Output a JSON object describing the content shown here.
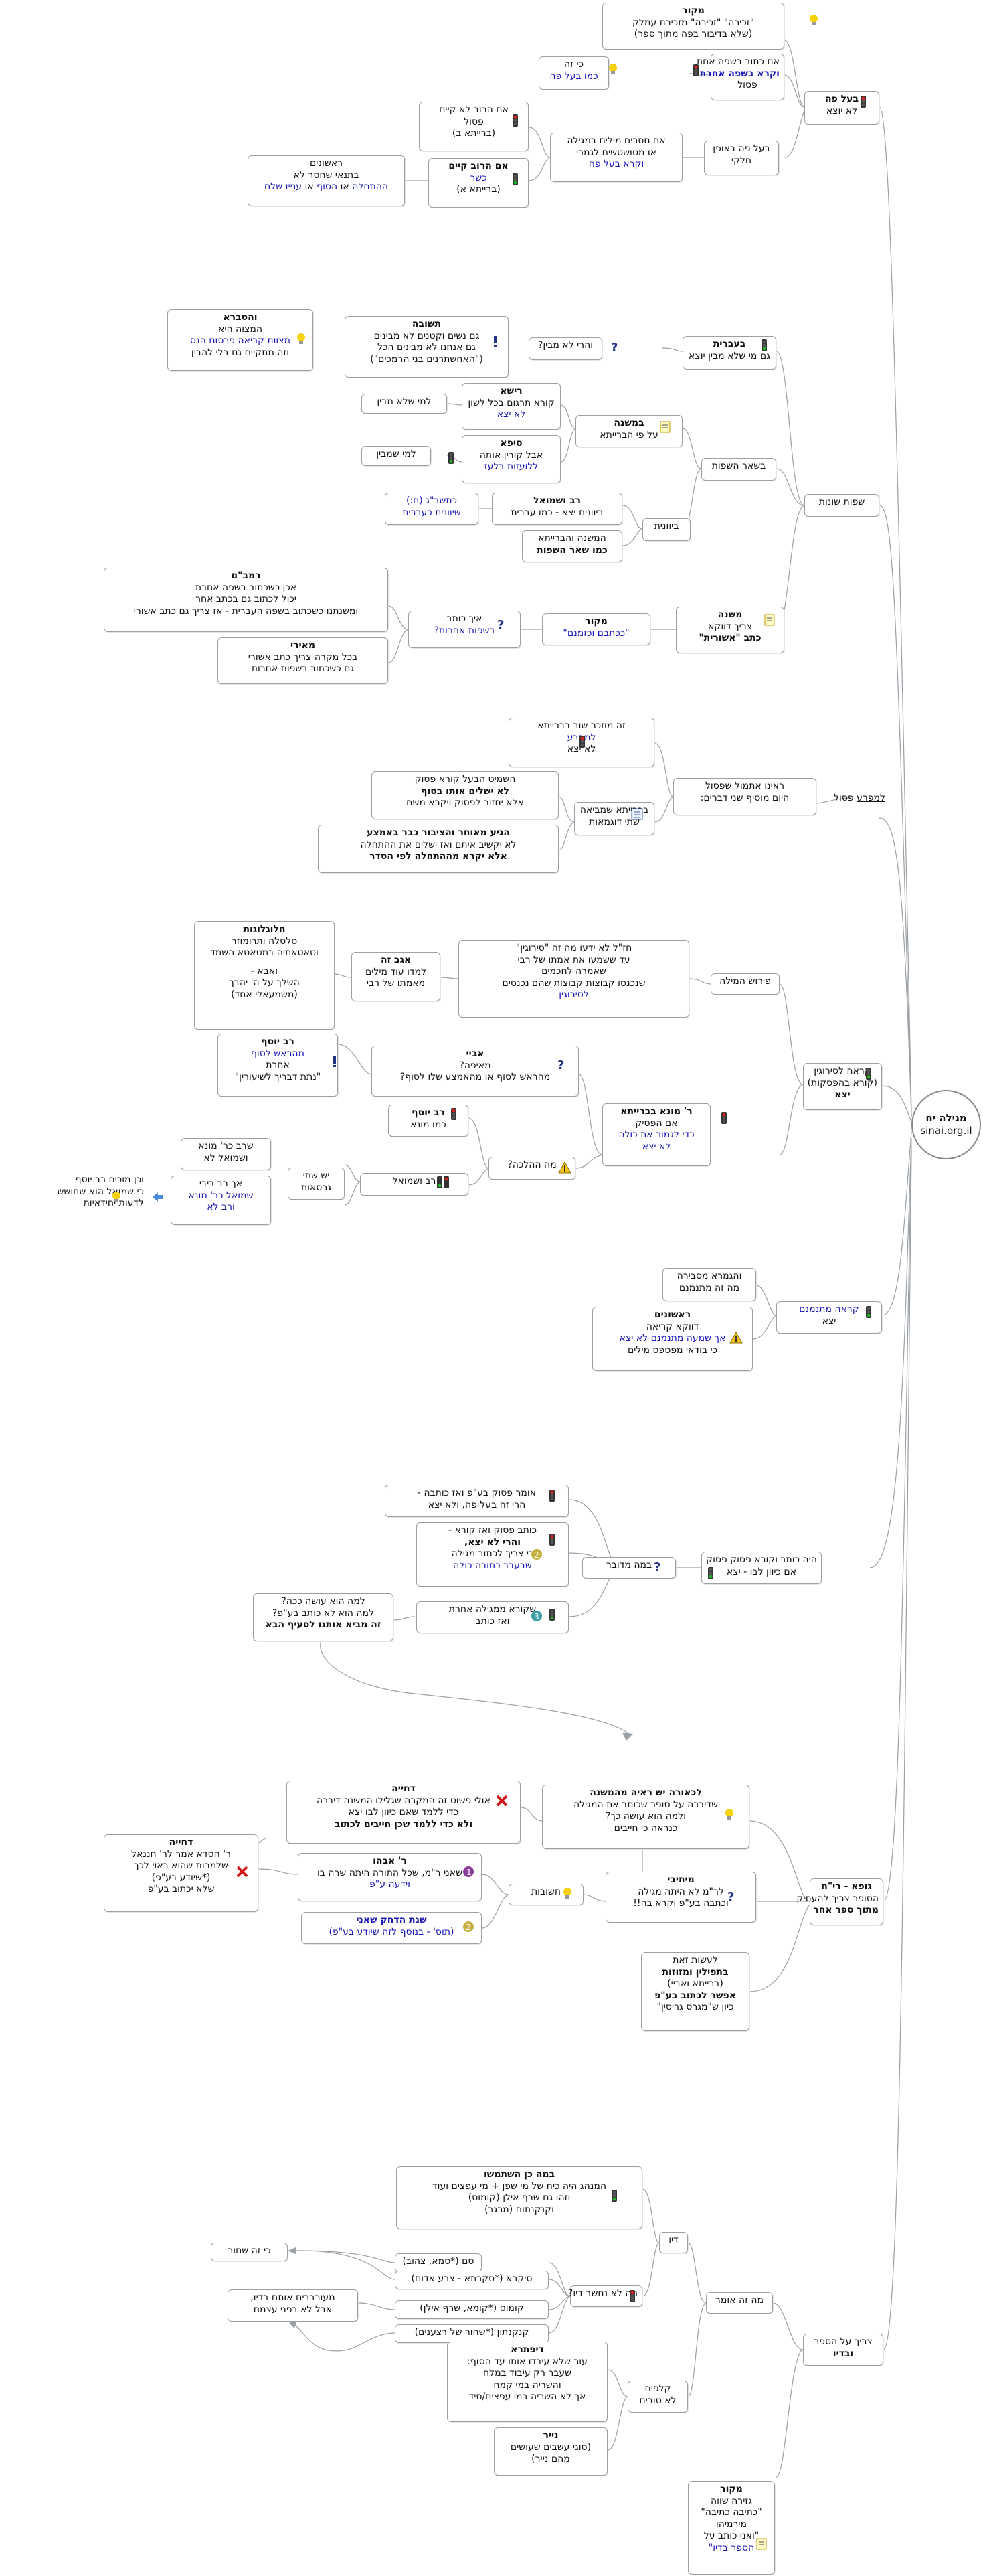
{
  "center": {
    "l1": "מגילה יח",
    "l2": "sinai.org.il"
  },
  "colors": {
    "line": "#9aa0a6",
    "blue": "#1a1ab8",
    "red": "#d01818",
    "green": "#2a9a2a",
    "warn": "#f0c020"
  },
  "n": {
    "s1": {
      "l1": "מקור",
      "l2": "\"זכירה\" \"זכירה\" מזכירת עמלק",
      "l3": "(שלא בדיבור בפה מתוך ספר)"
    },
    "s2": {
      "l1": "כי זה",
      "l2": "כמו בעל פה"
    },
    "s3": {
      "l1": "אם כתוב בשפה אחת",
      "l2": "וקרא בשפה אחרת",
      "l3": "פסול"
    },
    "s4": {
      "l1": "בעל פה",
      "l2": "לא יוצא"
    },
    "s5": {
      "l1": "אם הרוב לא קיים",
      "l2": "פסול",
      "l3": "(ברייתא ב)"
    },
    "s6": {
      "l1": "אם חסרים מילים במגילה",
      "l2": "או מטושטשים לגמרי",
      "l3": "וקרא בעל פה"
    },
    "s7": {
      "l1": "בעל פה באופן",
      "l2": "חלקי"
    },
    "s8": {
      "l1": "ראשונים",
      "l2": "בתנאי שחסר לא",
      "l3a": "ההתחלה",
      "l3b": " או ",
      "l3c": "הסוף",
      "l3d": " או ",
      "l3e": "ענייו",
      "l3f": " שלם"
    },
    "s9": {
      "l1": "אם הרוב קיים",
      "l2": "כשר",
      "l3": "(ברייתא א)"
    },
    "g1": {
      "l1": "והסברא",
      "l2": "המצוה היא",
      "l3": "פרסום הנס",
      "l3p": "מצוות קריאה ",
      "l4": "וזה מתקיים גם בלי להבין"
    },
    "g2": {
      "l1": "תשובה",
      "l2": "גם נשים וקטנים לא מבינים",
      "l3": "גם אנחנו לא מבינים הכל",
      "l4": "(\"האחשתרנים בני הרמכים\")"
    },
    "g3": {
      "l1": "והרי לא מבין?"
    },
    "g4": {
      "l1": "בעברית",
      "l2": "גם מי שלא מבין יוצא"
    },
    "g5": {
      "l1": "רישא",
      "l2": "קורא תרגום בכל לשון",
      "l3": "לא יצא"
    },
    "g6": {
      "l1": "למי שלא מבין"
    },
    "g7": {
      "l1": "במשנה",
      "l2": "על פי הברייתא"
    },
    "g8": {
      "l1": "סיפא",
      "l2": "אבל קורין אותה",
      "l3": "ללועזות בלעז"
    },
    "g9": {
      "l1": "למי שמבין"
    },
    "g10": {
      "l1": "בשאר השפות"
    },
    "g11": {
      "l1": "כתשב\"ג (ח:)",
      "l2": "שיוונית כעברית"
    },
    "g12": {
      "l1": "רב ושמואל",
      "l2": "ביוונית יצא - כמו עברית"
    },
    "g13": {
      "l1": "ביוונית"
    },
    "g14": {
      "l1": "המשנה והברייתא",
      "l2": "כמו שאר השפות"
    },
    "g15": {
      "l1": "שפות שונות"
    },
    "g16": {
      "l1": "רמב\"ם",
      "l2": "אכן כשכתוב בשפה אחרת",
      "l3": "יכול לכתוב גם בכתב אחר",
      "l4": "ומשנתנו כשכתוב בשפה העברית - אז צריך גם כתב אשורי"
    },
    "g17": {
      "l1": "איך כותב",
      "l2": "בשפות אחרות?"
    },
    "g18": {
      "l1": "מקור",
      "l2": "\"ככתבם וכזמנם\""
    },
    "g19": {
      "l1": "משנה",
      "l2": "צריך דווקא",
      "l3": "כתב \"אשורית\""
    },
    "g20": {
      "l1": "מאירי",
      "l2": "בכל מקרה צריך כתב אשורי",
      "l3": "גם כשכתוב בשפות אחרות"
    },
    "k1": {
      "l1": "זה מוזכר שוב בברייתא",
      "l2": "למפרע",
      "l3": "לא יצא"
    },
    "k2": {
      "l1": "למפרע פסול"
    },
    "k3": {
      "l1": "ראינו אתמול שפסול",
      "l2": "היום מוסיף שני דברים:"
    },
    "k4": {
      "l1": "השמיט הבעל קורא פסוק",
      "l2": "לא ישלים אותו בסוף",
      "l3": "אלא יחזור לפסוק ויקרא משם"
    },
    "k5": {
      "l1": "בברייתא שמביאה",
      "l2": "שתי דוגמאות"
    },
    "k6": {
      "l1": "הגיע מאוחר והציבור כבר באמצע",
      "l2": "לא יקשיב איתם ואז ישלים את ההתחלה",
      "l3": "אלא יקרא מההתחלה לפי הסדר"
    },
    "r1": {
      "l1": "חלוגלוגות",
      "l2": "סלסלה ותרומוזר",
      "l3": "וטאטאתיה במטאטא השמד",
      "l4": "ואבא -",
      "l5": "השלך על ה' יהבך",
      "l6": "(משמעאלי אחד)"
    },
    "r2": {
      "l1": "אגב זה",
      "l2": "למדו עוד מילים",
      "l3": "מאמתו של רבי"
    },
    "r3": {
      "l1": "חז\"ל לא ידעו מה זה \"סירוגין\"",
      "l2": "עד ששמעו את אמתו של רבי",
      "l3": "שאמרה לחכמים",
      "l4": "שנכנסו קבוצות קבוצות שהם נכנסים",
      "l5": "לסירוגין"
    },
    "r4": {
      "l1": "פירוש המילה"
    },
    "r5": {
      "l1": "רב יוסף",
      "l2": "מהראש לסוף",
      "l3": "אחרת",
      "l4": "\"נתת דבריך לשיעורין\""
    },
    "r6": {
      "l1": "אביי",
      "l2": "מאיפה?",
      "l3": "מהראש לסוף או מהאמצע שלו לסוף?"
    },
    "r7": {
      "l1": "קראה לסירוגין",
      "l2": "(קורא בהפסקות)",
      "l3": "יצא"
    },
    "r8": {
      "l1": "רב יוסף",
      "l2": "כמו מונא"
    },
    "r9": {
      "l1": "ר' מונא בברייתא",
      "l2": "אם הפסיק",
      "l3": "כדי לגמור את כולה",
      "l4": "לא יצא"
    },
    "r10": {
      "l1": "מה ההלכה?"
    },
    "r11": {
      "l1": "שרב כר' מונא",
      "l2": "ושמואל לא"
    },
    "r12": {
      "l1": "יש שתי",
      "l2": "גרסאות"
    },
    "r13": {
      "l1": "רב ושמואל"
    },
    "r14": {
      "l1": "אך רב ביבי",
      "l2": "שמואל כר' מונא",
      "l3": "ורב לא"
    },
    "r15": {
      "l1": "וכן מוכיח רב יוסף",
      "l2": "כי שמואל הוא שחושש",
      "l3": "לדעות יחידאיות"
    },
    "m1": {
      "l1": "והגמרא מסבירה",
      "l2": "מה זה מתנמנם"
    },
    "m2": {
      "l1": "קראה מתנמנם",
      "l2": "יצא"
    },
    "m3": {
      "l1": "ראשונים",
      "l2": "דווקא קריאה",
      "l3": "אך שמעה מתנמנם לא יצא",
      "l4": "כי בודאי מפספס מילים"
    },
    "w1": {
      "l1": "אומר פסוק בע\"פ ואז כותבה -",
      "l2": "הרי זה בעל פה, ולא יצא"
    },
    "w2": {
      "l1": "כותב פסוק ואז קורא -",
      "l2": "והרי לא יצא,",
      "l3": "כי צריך לכתוב מגילה",
      "l4": "שבעבר כתובה כולה"
    },
    "w3": {
      "l1": "במה מדובר"
    },
    "w4": {
      "l1": "היה כותב וקורא פסוק פסוק",
      "l2": "אם כיוון לבו - יצא"
    },
    "w5": {
      "l1": "שקורא ממגילה אחרת",
      "l2": "ואז כותב"
    },
    "w6": {
      "l1": "למה הוא עושה ככה?",
      "l2": "למה הוא לא כותב בע\"פ?",
      "l3": "זה מביא אותנו לסעיף הבא"
    },
    "t1": {
      "l1": "דחייה",
      "l2": "אולי פשוט זה המקרה שגלילו המשנה דיברה",
      "l3": "כדי ללמד שאם כיוון לבו יצא",
      "l4": "ולא כדי ללמד שכן חייבים לכתוב"
    },
    "t2": {
      "l1": "לכאורה יש ראיה מהמשנה",
      "l2": "שדיברה על סופר שכותב את המגילה",
      "l3": "ולמה הוא עושה כך?",
      "l4": "כנראה כי חייבים"
    },
    "t3": {
      "l1": "דחייה",
      "l2": "ר' חסדא אמר לר' חננאל",
      "l3": "שלמרות שהוא ראוי לכך",
      "l4": "(*שיודע בע\"פ)",
      "l5": "שלא יכתוב בע\"פ"
    },
    "t4": {
      "l1": "ר' אבהו",
      "l2": "שאני ר\"מ, שכל התורה היתה שרה בו",
      "l3": "וידעה ע\"פ"
    },
    "t5": {
      "l1": "תשובות"
    },
    "t6": {
      "l1": "מיתיבי",
      "l2": "לר\"מ לא היתה מגילה",
      "l3": "וכתבה בע\"פ וקרא בה!!"
    },
    "t7": {
      "l1": "שנת הדחק שאני",
      "l2": "(תוס' - בנוסף לזה שיודע בע\"פ)"
    },
    "t8": {
      "l1": "גופא - רי\"ח",
      "l2": "הסופר צריך להעתיק",
      "l3": "מתוך ספר אחר"
    },
    "t9": {
      "l1": "לעשות זאת",
      "l2": "בתפילין ומזוזות",
      "l3": "(ברייתא ואביי)",
      "l4": "אפשר לכתוב בע\"פ",
      "l5": "כיון ש\"מגרס גריסין\""
    },
    "d1": {
      "l1": "במה כן השתמשו",
      "l2": "המנהג היה כיח של מי שפן + מי עפצים ועוד",
      "l3": "וזהו גם שרף אילן (קומוס)",
      "l4": "וקנקנתום (מרגב)"
    },
    "d2": {
      "l1": "כי זה שחור"
    },
    "d3": {
      "l1": "סם (*סמא, צהוב)"
    },
    "d4": {
      "l1": "סיקרא (*סקרתא - צבע אדום)"
    },
    "d5": {
      "l1": "מה לא נחשב דיו?"
    },
    "d6": {
      "l1": "דיו"
    },
    "d7": {
      "l1": "מעורבבים אותם בדיו,",
      "l2": "אבל לא בפני עצמם"
    },
    "d8": {
      "l1": "קומוס (*קומא, שרף אילן)"
    },
    "d9": {
      "l1": "קנקנתון (*שחור של רצענים)"
    },
    "d10": {
      "l1": "מה זה אומר"
    },
    "d11": {
      "l1": "צריך על הספר",
      "l2": "ובדיו"
    },
    "d12": {
      "l1": "דיפתרא",
      "l2": "עור שלא עיבדו אותו עד הסוף:",
      "l3": "שעבר רק עיבוד במלח",
      "l4": "והשריה במי קמח",
      "l5": "אך לא השריה במי עפצים/סיד"
    },
    "d13": {
      "l1": "קלפים",
      "l2": "לא טובים"
    },
    "d14": {
      "l1": "נייר",
      "l2": "(סוגי עשבים שעושים",
      "l3": "מהם נייר)"
    },
    "d15": {
      "l1": "מקור",
      "l2": "גזירה שווה",
      "l3": "\"כתיבה כתיבה\"",
      "l4": "מירמיהו",
      "l5": "\"ואני כותב על",
      "l6": "הספר בדיו\""
    }
  }
}
